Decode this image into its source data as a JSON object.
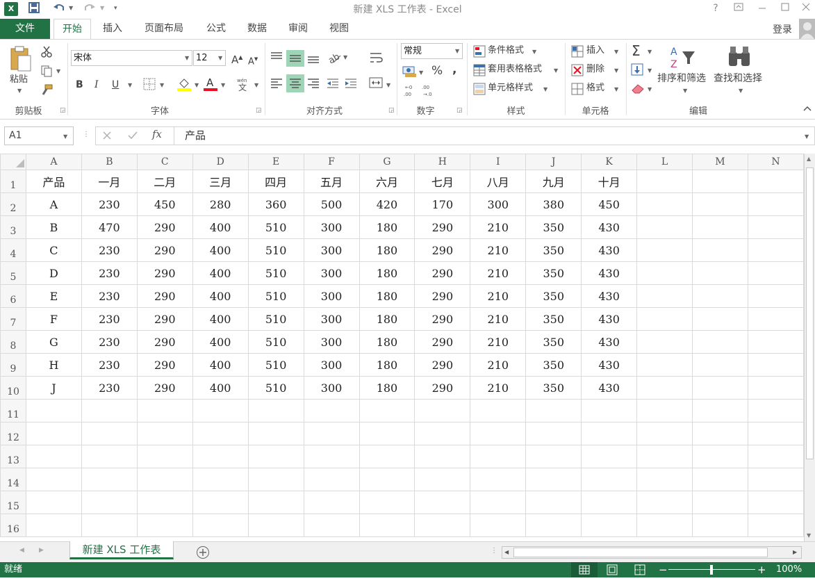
{
  "window": {
    "title": "新建 XLS 工作表 - Excel",
    "excel_icon": "X",
    "help": "?"
  },
  "tabs": {
    "file": "文件",
    "items": [
      "开始",
      "插入",
      "页面布局",
      "公式",
      "数据",
      "审阅",
      "视图"
    ],
    "login": "登录"
  },
  "ribbon": {
    "paste": "粘贴",
    "font_name": "宋体",
    "font_size": "12",
    "bold": "B",
    "italic": "I",
    "underline": "U",
    "number_format": "常规",
    "percent": "%",
    "comma": ",",
    "cond_format": "条件格式",
    "table_format": "套用表格格式",
    "cell_style": "单元格样式",
    "insert": "插入",
    "delete": "删除",
    "format": "格式",
    "sort_filter": "排序和筛选",
    "find_select": "查找和选择",
    "groups": {
      "clipboard": "剪贴板",
      "font": "字体",
      "alignment": "对齐方式",
      "number": "数字",
      "styles": "样式",
      "cells": "单元格",
      "editing": "编辑"
    }
  },
  "formula_bar": {
    "name_box": "A1",
    "fx": "fx",
    "content": "产品"
  },
  "grid": {
    "columns": [
      "A",
      "B",
      "C",
      "D",
      "E",
      "F",
      "G",
      "H",
      "I",
      "J",
      "K",
      "L",
      "M",
      "N"
    ],
    "row_numbers": [
      "1",
      "2",
      "3",
      "4",
      "5",
      "6",
      "7",
      "8",
      "9",
      "10",
      "11",
      "12",
      "13",
      "14",
      "15",
      "16"
    ],
    "rows": [
      [
        "产品",
        "一月",
        "二月",
        "三月",
        "四月",
        "五月",
        "六月",
        "七月",
        "八月",
        "九月",
        "十月"
      ],
      [
        "A",
        "230",
        "450",
        "280",
        "360",
        "500",
        "420",
        "170",
        "300",
        "380",
        "450"
      ],
      [
        "B",
        "470",
        "290",
        "400",
        "510",
        "300",
        "180",
        "290",
        "210",
        "350",
        "430"
      ],
      [
        "C",
        "230",
        "290",
        "400",
        "510",
        "300",
        "180",
        "290",
        "210",
        "350",
        "430"
      ],
      [
        "D",
        "230",
        "290",
        "400",
        "510",
        "300",
        "180",
        "290",
        "210",
        "350",
        "430"
      ],
      [
        "E",
        "230",
        "290",
        "400",
        "510",
        "300",
        "180",
        "290",
        "210",
        "350",
        "430"
      ],
      [
        "F",
        "230",
        "290",
        "400",
        "510",
        "300",
        "180",
        "290",
        "210",
        "350",
        "430"
      ],
      [
        "G",
        "230",
        "290",
        "400",
        "510",
        "300",
        "180",
        "290",
        "210",
        "350",
        "430"
      ],
      [
        "H",
        "230",
        "290",
        "400",
        "510",
        "300",
        "180",
        "290",
        "210",
        "350",
        "430"
      ],
      [
        "J",
        "230",
        "290",
        "400",
        "510",
        "300",
        "180",
        "290",
        "210",
        "350",
        "430"
      ]
    ]
  },
  "sheet_tabs": {
    "active": "新建 XLS 工作表"
  },
  "status": {
    "ready": "就绪",
    "zoom": "100%"
  },
  "colors": {
    "accent": "#217346",
    "align_highlight": "#9fd5b7"
  }
}
